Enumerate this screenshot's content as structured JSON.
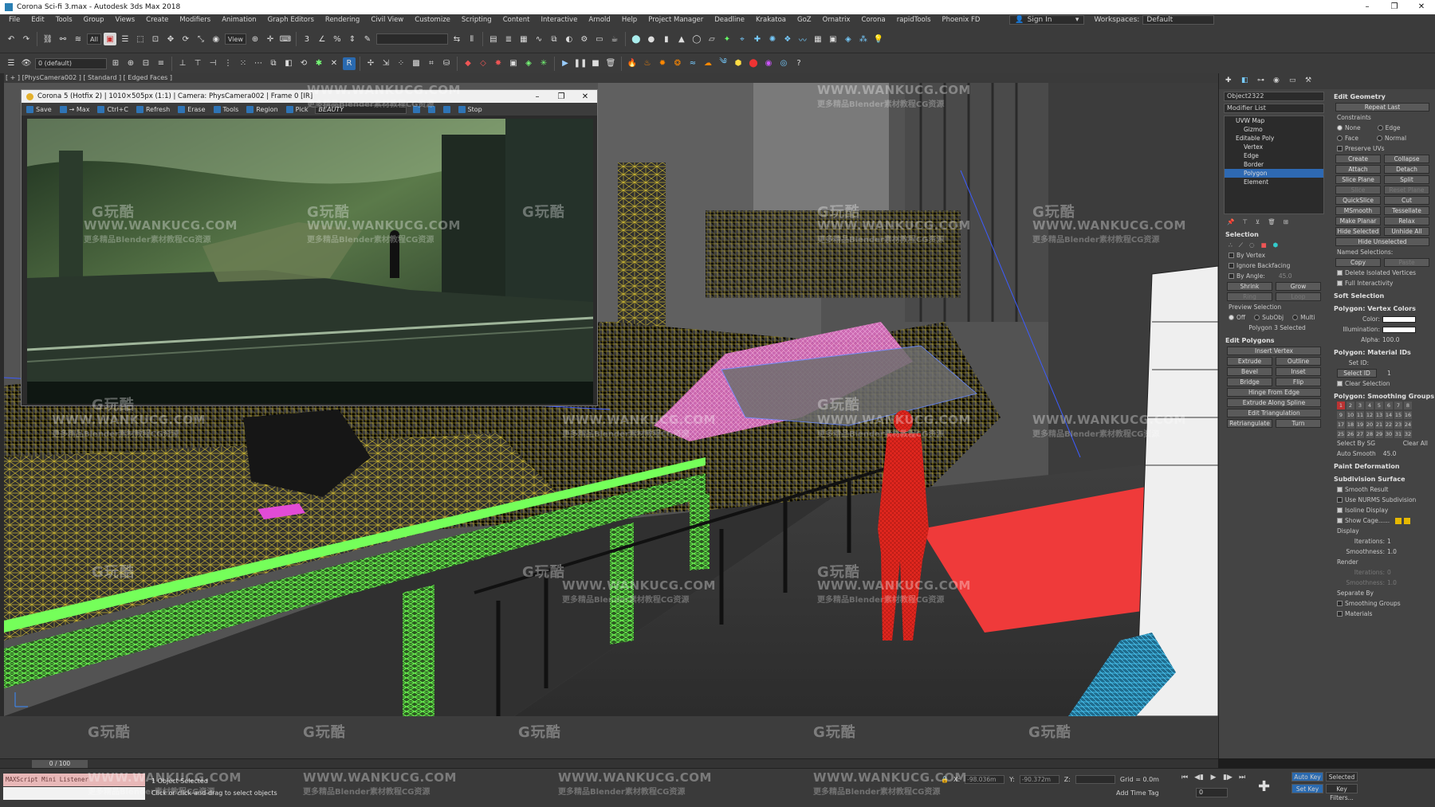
{
  "window": {
    "title": "Corona Sci-fi 3.max - Autodesk 3ds Max 2018",
    "controls": [
      "–",
      "❐",
      "✕"
    ]
  },
  "menu": {
    "items": [
      "File",
      "Edit",
      "Tools",
      "Group",
      "Views",
      "Create",
      "Modifiers",
      "Animation",
      "Graph Editors",
      "Rendering",
      "Civil View",
      "Customize",
      "Scripting",
      "Content",
      "Interactive",
      "Arnold",
      "Help",
      "Project Manager",
      "Deadline",
      "Krakatoa",
      "GoZ",
      "Ornatrix",
      "Corona",
      "rapidTools",
      "Phoenix FD"
    ],
    "sign_in": "Sign In",
    "workspaces_label": "Workspaces:",
    "workspace_value": "Default"
  },
  "toolbar": {
    "selection_filter": "All",
    "reference_coord": "View",
    "layer_dropdown": "0 (default)"
  },
  "viewport": {
    "label": "[ + ] [PhysCamera002 ] [ Standard ] [ Edged Faces ]"
  },
  "vfb": {
    "title": "Corona 5 (Hotfix 2) | 1010×505px (1:1) | Camera: PhysCamera002 | Frame 0 [IR]",
    "tools": [
      "Save",
      "→ Max",
      "Ctrl+C",
      "Refresh",
      "Erase",
      "Tools",
      "Region",
      "Pick"
    ],
    "channel": "BEAUTY",
    "stop_label": "Stop"
  },
  "command_panel": {
    "object_name": "Object2322",
    "modifier_list": "Modifier List",
    "stack": [
      {
        "label": "UVW Map",
        "sub": false,
        "selected": false
      },
      {
        "label": "Gizmo",
        "sub": true,
        "selected": false
      },
      {
        "label": "Editable Poly",
        "sub": false,
        "selected": false
      },
      {
        "label": "Vertex",
        "sub": true,
        "selected": false
      },
      {
        "label": "Edge",
        "sub": true,
        "selected": false
      },
      {
        "label": "Border",
        "sub": true,
        "selected": false
      },
      {
        "label": "Polygon",
        "sub": true,
        "selected": true
      },
      {
        "label": "Element",
        "sub": true,
        "selected": false
      }
    ],
    "selection": {
      "header": "Selection",
      "by_vertex": "By Vertex",
      "ignore_backfacing": "Ignore Backfacing",
      "by_angle": "By Angle:",
      "angle_value": "45.0",
      "shrink": "Shrink",
      "grow": "Grow",
      "ring": "Ring",
      "loop": "Loop",
      "preview_selection": "Preview Selection",
      "preview_off": "Off",
      "preview_subobj": "SubObj",
      "preview_multi": "Multi",
      "status": "Polygon 3 Selected"
    },
    "edit_polygons": {
      "header": "Edit Polygons",
      "insert_vertex": "Insert Vertex",
      "extrude": "Extrude",
      "outline": "Outline",
      "bevel": "Bevel",
      "inset": "Inset",
      "bridge": "Bridge",
      "flip": "Flip",
      "hinge": "Hinge From Edge",
      "extrude_spline": "Extrude Along Spline",
      "edit_triangulation": "Edit Triangulation",
      "retriangulate": "Retriangulate",
      "turn": "Turn"
    },
    "edit_geometry": {
      "header": "Edit Geometry",
      "repeat_last": "Repeat Last",
      "constraints": "Constraints",
      "none": "None",
      "edge": "Edge",
      "face": "Face",
      "normal": "Normal",
      "preserve_uvs": "Preserve UVs",
      "create": "Create",
      "collapse": "Collapse",
      "attach": "Attach",
      "detach": "Detach",
      "slice_plane": "Slice Plane",
      "split": "Split",
      "slice": "Slice",
      "reset_plane": "Reset Plane",
      "quickslice": "QuickSlice",
      "cut": "Cut",
      "msmooth": "MSmooth",
      "tessellate": "Tessellate",
      "make_planar": "Make Planar",
      "relax": "Relax",
      "hide_selected": "Hide Selected",
      "unhide_all": "Unhide All",
      "hide_unselected": "Hide Unselected",
      "named_selections": "Named Selections:",
      "copy": "Copy",
      "paste": "Paste",
      "delete_isolated": "Delete Isolated Vertices",
      "full_interactivity": "Full Interactivity"
    },
    "soft_selection": "Soft Selection",
    "vertex_colors": {
      "header": "Polygon: Vertex Colors",
      "color": "Color:",
      "illumination": "Illumination:",
      "alpha": "Alpha:",
      "alpha_value": "100.0"
    },
    "material_ids": {
      "header": "Polygon: Material IDs",
      "set_id": "Set ID:",
      "select_id": "Select ID",
      "id_value": "1",
      "clear_selection": "Clear Selection"
    },
    "smoothing": {
      "header": "Polygon: Smoothing Groups",
      "groups": [
        "1",
        "2",
        "3",
        "4",
        "5",
        "6",
        "7",
        "8",
        "9",
        "10",
        "11",
        "12",
        "13",
        "14",
        "15",
        "16",
        "17",
        "18",
        "19",
        "20",
        "21",
        "22",
        "23",
        "24",
        "25",
        "26",
        "27",
        "28",
        "29",
        "30",
        "31",
        "32"
      ],
      "select_by_sg": "Select By SG",
      "clear_all": "Clear All",
      "auto_smooth": "Auto Smooth",
      "auto_value": "45.0"
    },
    "paint_deformation": "Paint Deformation",
    "subdivision": {
      "header": "Subdivision Surface",
      "smooth_result": "Smooth Result",
      "use_nurms": "Use NURMS Subdivision",
      "isoline": "Isoline Display",
      "show_cage": "Show Cage......",
      "display": "Display",
      "iterations": "Iterations:",
      "iterations_value": "1",
      "smoothness": "Smoothness:",
      "smoothness_value": "1.0",
      "render": "Render",
      "r_iterations": "Iterations:",
      "r_iterations_value": "0",
      "r_smoothness": "Smoothness:",
      "r_smoothness_value": "1.0",
      "separate_by": "Separate By",
      "smoothing_groups": "Smoothing Groups",
      "materials": "Materials"
    }
  },
  "timeline": {
    "frame": "0 / 100"
  },
  "status": {
    "maxscript_line1": "MAXScript Mini Listener",
    "maxscript_line2": "",
    "selected": "1 Object Selected",
    "hint": "Click or click-and-drag to select objects",
    "x_label": "X:",
    "x_value": "-98.036m",
    "y_label": "Y:",
    "y_value": "-90.372m",
    "z_label": "Z:",
    "grid": "Grid = 0.0m",
    "add_time_tag": "Add Time Tag",
    "auto_key": "Auto Key",
    "selected_key": "Selected",
    "set_key": "Set Key",
    "key_filters": "Key Filters...",
    "current_frame": "0"
  },
  "watermark": {
    "logo": "G玩酷",
    "site": "WWW.WANKUCG.COM",
    "tag": "更多精品Blender素材教程CG资源"
  },
  "colors": {
    "accent": "#2e69b3",
    "wire_yellow": "#d8c23a",
    "wire_green": "#5cff4a",
    "wire_pink": "#ff8ad8",
    "red_figure": "#e0261e",
    "cyan_obj": "#36b8e6"
  }
}
